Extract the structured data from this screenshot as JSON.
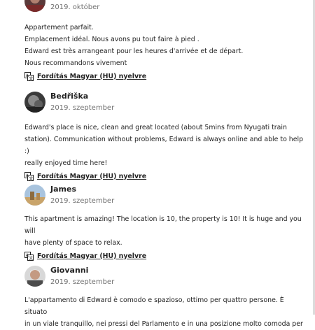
{
  "reviews": [
    {
      "name": "",
      "date": "2019. október",
      "lines": [
        "Appartement parfait.",
        "Emplacement idéal. Nous avons pu tout faire à pied .",
        "Edward est très arrangeant pour les heures d'arrivée et de départ.",
        "Nous recommandons vivement"
      ],
      "translate_label": "Fordítás Magyar (HU) nyelvre"
    },
    {
      "name": "Bedřiška",
      "date": "2019. szeptember",
      "lines": [
        "Edward's place is nice, clean and great located (about 5mins from Nyugati train",
        "station). Communication without problems, Edward is always online and able to help :)",
        "really enjoyed time here!"
      ],
      "translate_label": "Fordítás Magyar (HU) nyelvre"
    },
    {
      "name": "James",
      "date": "2019. szeptember",
      "lines": [
        "This apartment is amazing! The location is 10, the property is 10! It is huge and you will",
        "have plenty of space to relax."
      ],
      "translate_label": "Fordítás Magyar (HU) nyelvre"
    },
    {
      "name": "Giovanni",
      "date": "2019. szeptember",
      "lines": [
        "L'appartamento di Edward è comodo e spazioso, ottimo per quattro persone. È situato",
        "in un viale tranquillo, nei pressi del Parlamento e in una posizione molto comoda per"
      ],
      "translate_label": ""
    }
  ]
}
